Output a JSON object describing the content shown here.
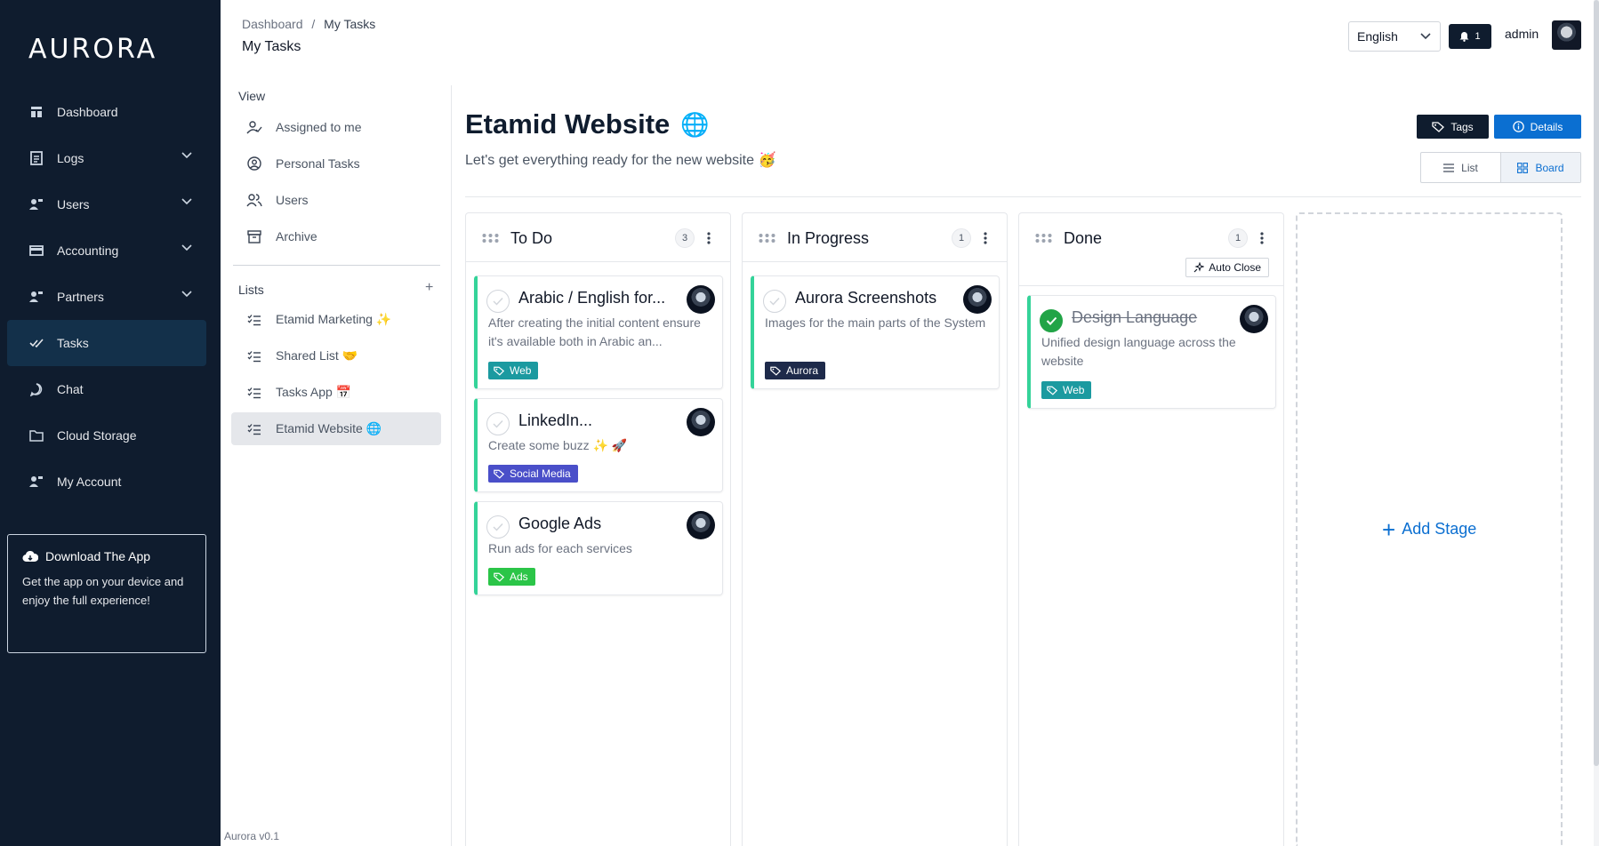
{
  "sidebar": {
    "logo": "AURORA",
    "items": [
      {
        "label": "Dashboard",
        "icon": "dashboard-icon"
      },
      {
        "label": "Logs",
        "icon": "logs-icon",
        "expandable": true
      },
      {
        "label": "Users",
        "icon": "users-icon",
        "expandable": true
      },
      {
        "label": "Accounting",
        "icon": "accounting-icon",
        "expandable": true
      },
      {
        "label": "Partners",
        "icon": "partners-icon",
        "expandable": true
      },
      {
        "label": "Tasks",
        "icon": "tasks-icon",
        "active": true
      },
      {
        "label": "Chat",
        "icon": "chat-icon"
      },
      {
        "label": "Cloud Storage",
        "icon": "folder-icon"
      },
      {
        "label": "My Account",
        "icon": "account-icon"
      }
    ],
    "download": {
      "title": "Download The App",
      "text": "Get the app on your device and enjoy the full experience!"
    },
    "version": "Aurora v0.1"
  },
  "header": {
    "breadcrumb": [
      "Dashboard",
      "My Tasks"
    ],
    "breadcrumb_sep": "/",
    "page_title": "My Tasks",
    "language": "English",
    "notifications": "1",
    "username": "admin"
  },
  "lists_panel": {
    "view_heading": "View",
    "view_items": [
      {
        "label": "Assigned to me",
        "icon": "assigned-icon"
      },
      {
        "label": "Personal Tasks",
        "icon": "personal-icon"
      },
      {
        "label": "Users",
        "icon": "users-icon"
      },
      {
        "label": "Archive",
        "icon": "archive-icon"
      }
    ],
    "lists_heading": "Lists",
    "add_label": "+",
    "lists": [
      {
        "label": "Etamid Marketing ✨"
      },
      {
        "label": "Shared List 🤝"
      },
      {
        "label": "Tasks App 📅"
      },
      {
        "label": "Etamid Website 🌐",
        "active": true
      }
    ]
  },
  "board": {
    "title": "Etamid Website",
    "title_emoji": "🌐",
    "subtitle": "Let's get everything ready for the new website 🥳",
    "tags_button": "Tags",
    "details_button": "Details",
    "view_list": "List",
    "view_board": "Board",
    "add_stage": "Add Stage",
    "columns": [
      {
        "title": "To Do",
        "count": "3",
        "cards": [
          {
            "title": "Arabic / English for...",
            "desc": "After creating the initial content ensure it's available both in Arabic an...",
            "tag": "Web",
            "tag_color": "#1b9aa0",
            "done": false
          },
          {
            "title": "LinkedIn...",
            "desc": "Create some buzz ✨ 🚀",
            "tag": "Social Media",
            "tag_color": "#4a4fc9",
            "done": false
          },
          {
            "title": "Google Ads",
            "desc": "Run ads for each services",
            "tag": "Ads",
            "tag_color": "#2bc548",
            "done": false
          }
        ]
      },
      {
        "title": "In Progress",
        "count": "1",
        "cards": [
          {
            "title": "Aurora Screenshots",
            "desc": "Images for the main parts of the System",
            "tag": "Aurora",
            "tag_color": "#1e2a4a",
            "done": false
          }
        ]
      },
      {
        "title": "Done",
        "count": "1",
        "auto_close": "Auto Close",
        "cards": [
          {
            "title": "Design Language",
            "desc": "Unified design language across the website",
            "tag": "Web",
            "tag_color": "#1b9aa0",
            "done": true
          }
        ]
      }
    ]
  },
  "colors": {
    "sidebar_bg": "#0f1c2e",
    "accent": "#0b6fd1",
    "card_border_accent": "#34d399",
    "done_check": "#22a447"
  }
}
